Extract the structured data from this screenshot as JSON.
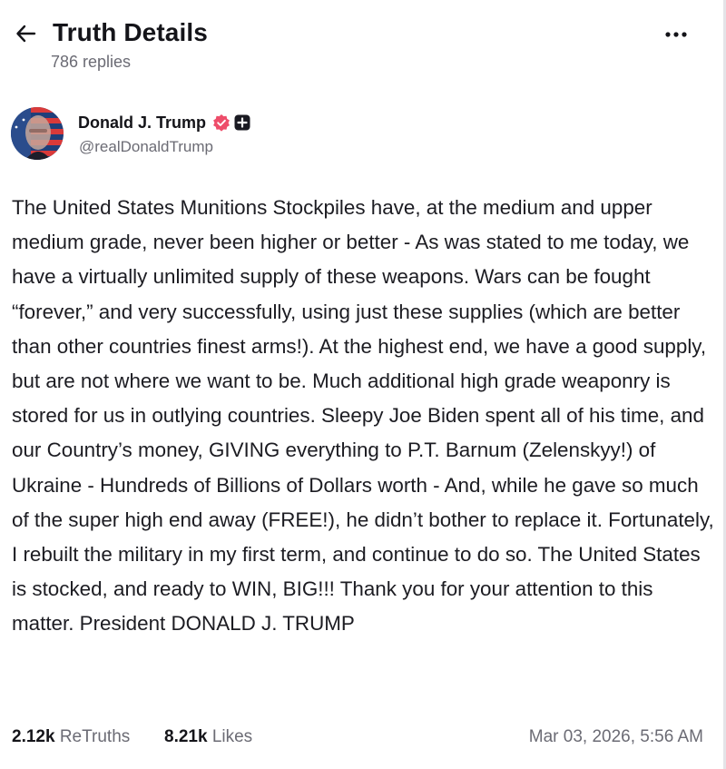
{
  "header": {
    "title": "Truth Details",
    "replies_count": "786 replies",
    "back_icon": "arrow-left-icon",
    "more_icon": "more-horizontal-icon"
  },
  "post": {
    "author": {
      "name": "Donald J. Trump",
      "handle": "@realDonaldTrump",
      "verified_icon": "verified-badge-icon",
      "verified_color": "#ee4d6a",
      "extra_badge_icon": "plus-square-icon"
    },
    "text": "The United States Munitions Stockpiles have, at the medium and upper medium grade, never been higher or better - As was stated to me today, we have a virtually unlimited supply of these weapons. Wars can be fought “forever,” and very successfully, using just these supplies (which are better than other countries finest arms!). At the highest end, we have a good supply, but are not where we want to be. Much additional high grade weaponry is stored for us in outlying countries. Sleepy Joe Biden spent all of his time, and our Country’s money, GIVING everything to P.T. Barnum (Zelenskyy!) of Ukraine - Hundreds of Billions of Dollars worth - And, while he gave so much of the super high end away (FREE!), he didn’t bother to replace it. Fortunately, I rebuilt the military in my first term, and continue to do so. The United States is stocked, and ready to WIN, BIG!!! Thank you for your attention to this matter. President DONALD J. TRUMP",
    "stats": {
      "retruths_count": "2.12k",
      "retruths_label": "ReTruths",
      "likes_count": "8.21k",
      "likes_label": "Likes"
    },
    "timestamp": "Mar 03, 2026, 5:56 AM"
  }
}
